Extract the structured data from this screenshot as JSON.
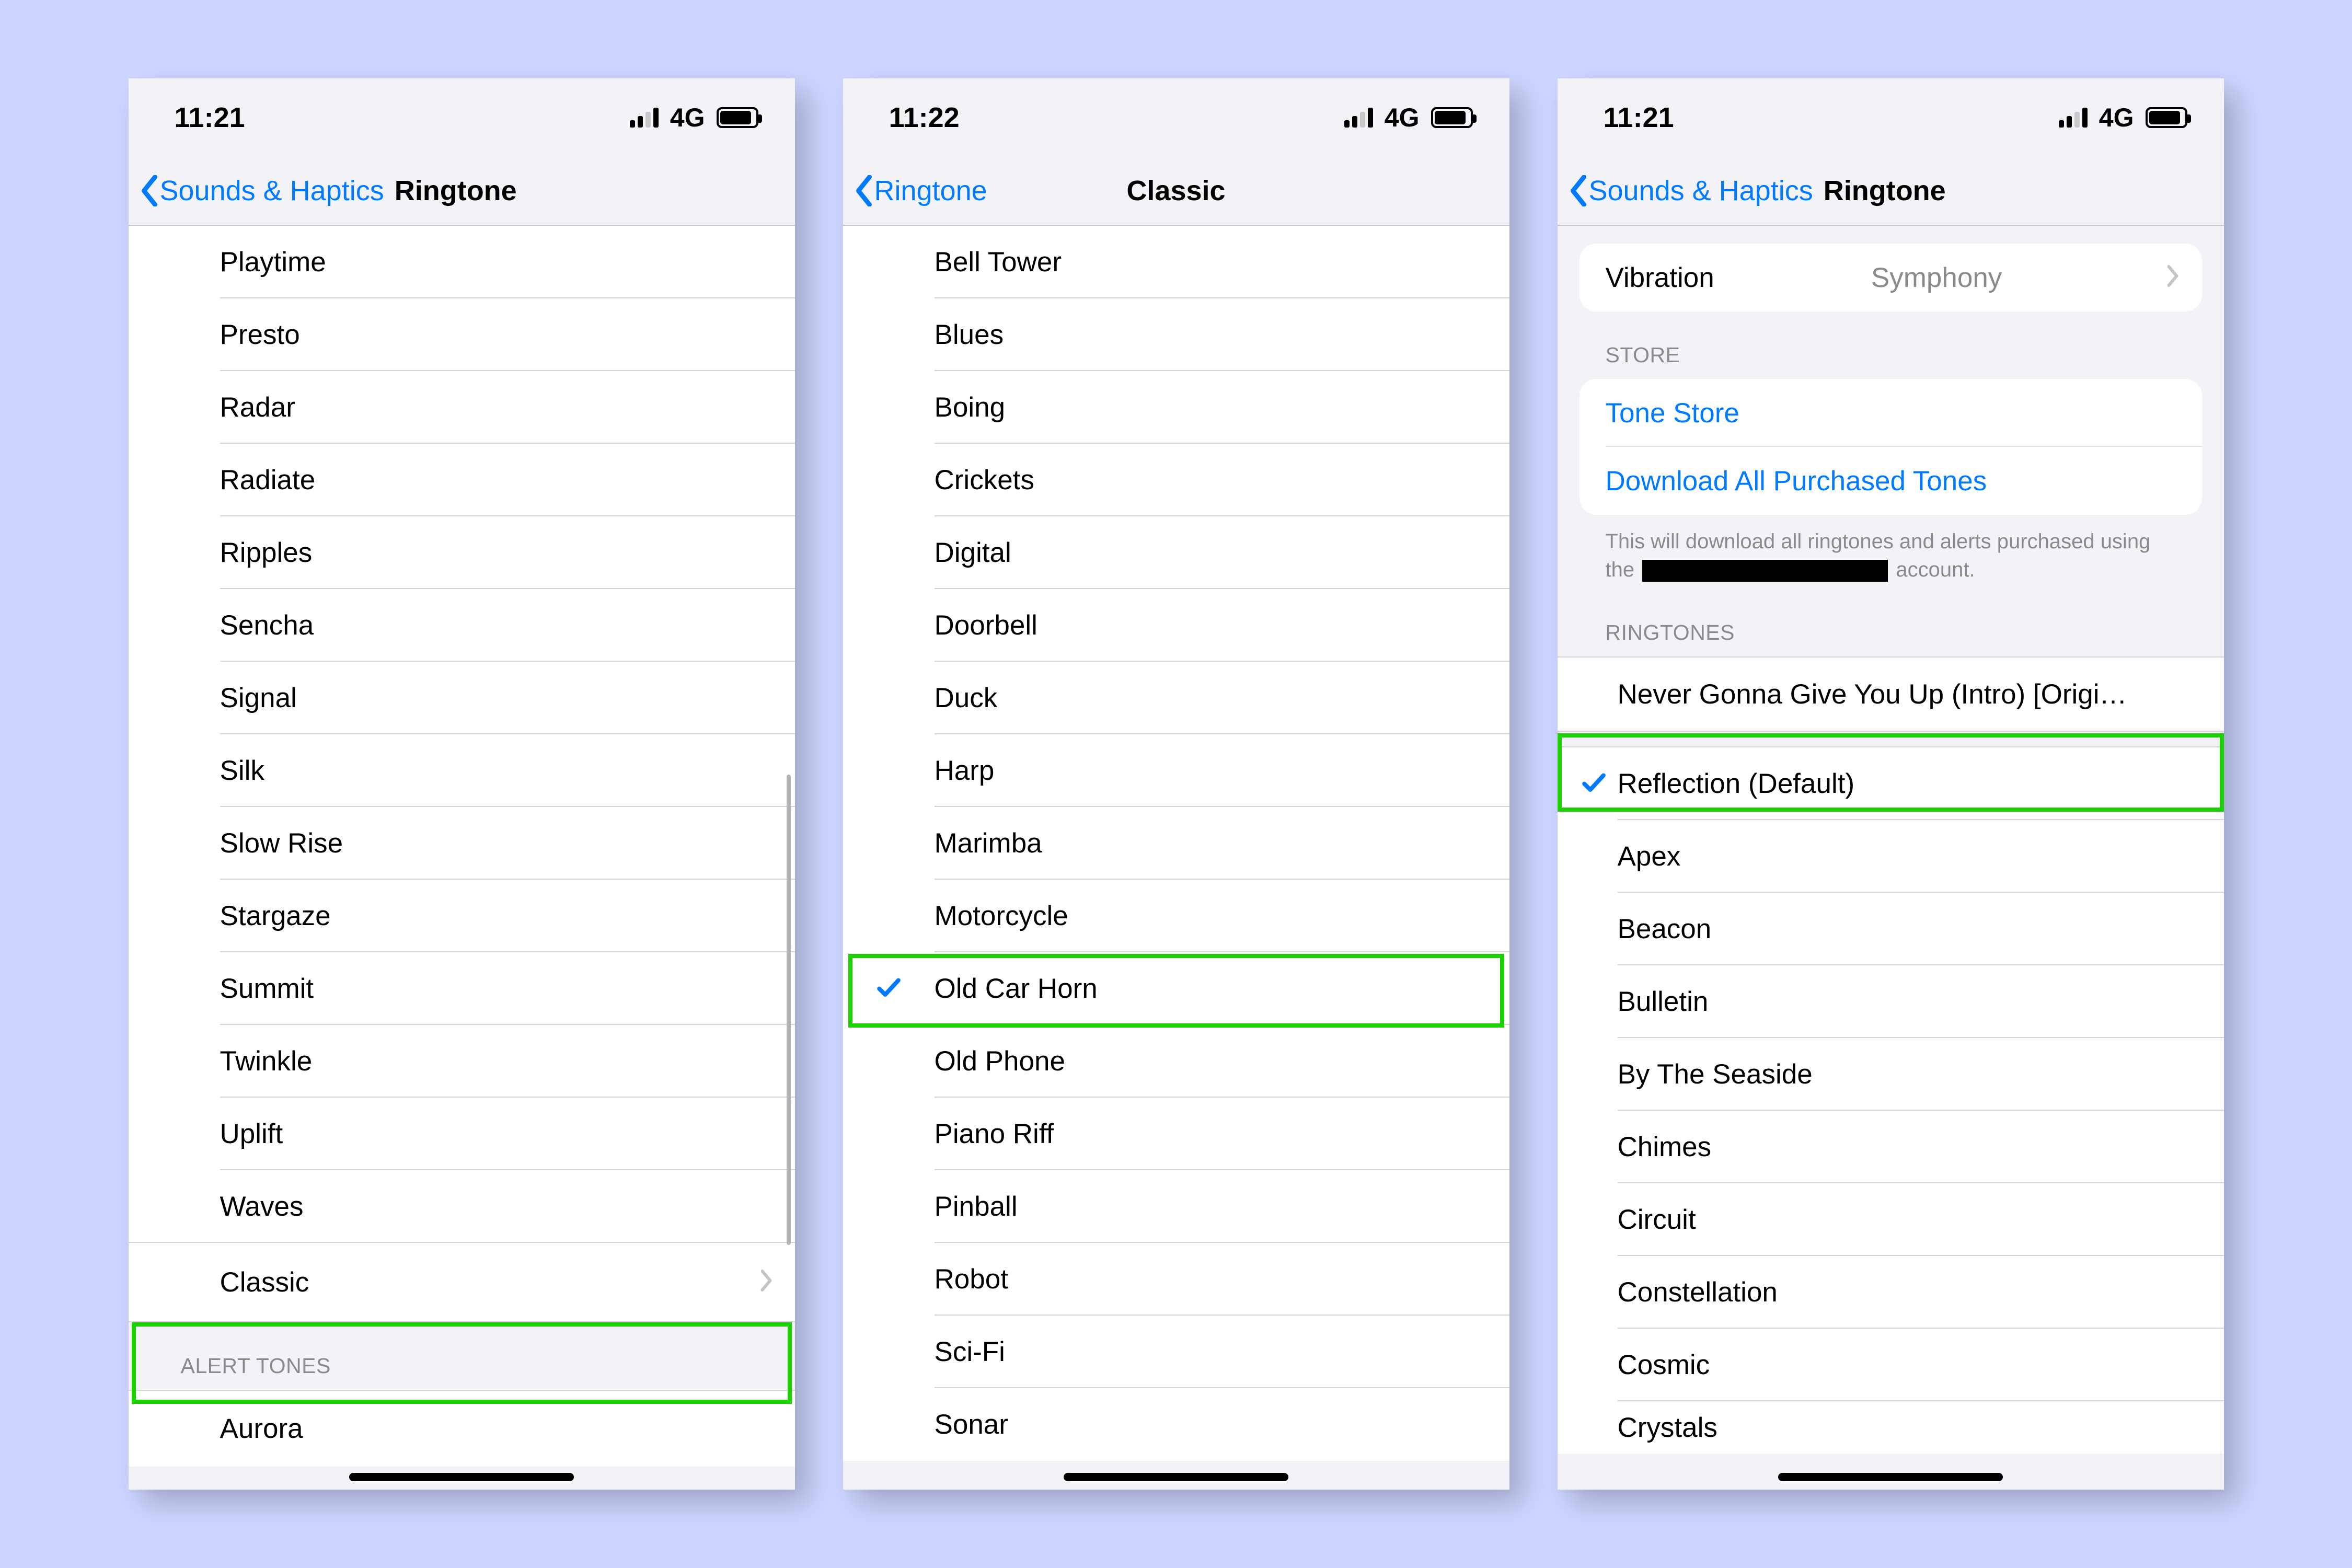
{
  "status": {
    "left_time": "11:21",
    "center_time": "11:22",
    "right_time": "11:21",
    "network": "4G"
  },
  "screen1": {
    "back": "Sounds & Haptics",
    "title": "Ringtone",
    "ringtones": [
      "Playtime",
      "Presto",
      "Radar",
      "Radiate",
      "Ripples",
      "Sencha",
      "Signal",
      "Silk",
      "Slow Rise",
      "Stargaze",
      "Summit",
      "Twinkle",
      "Uplift",
      "Waves"
    ],
    "classic": "Classic",
    "alert_header": "ALERT TONES",
    "alert_first": "Aurora"
  },
  "screen2": {
    "back": "Ringtone",
    "title": "Classic",
    "items": [
      "Bell Tower",
      "Blues",
      "Boing",
      "Crickets",
      "Digital",
      "Doorbell",
      "Duck",
      "Harp",
      "Marimba",
      "Motorcycle",
      "Old Car Horn",
      "Old Phone",
      "Piano Riff",
      "Pinball",
      "Robot",
      "Sci-Fi",
      "Sonar"
    ],
    "checked_index": 10
  },
  "screen3": {
    "back": "Sounds & Haptics",
    "title": "Ringtone",
    "vibration_label": "Vibration",
    "vibration_value": "Symphony",
    "store_header": "STORE",
    "tone_store": "Tone Store",
    "download_all": "Download All Purchased Tones",
    "footer_a": "This will download all ringtones and alerts purchased using the",
    "footer_b": "account.",
    "ringtones_header": "RINGTONES",
    "purchased": "Never Gonna Give You Up (Intro) [Origi…",
    "ringtones": [
      "Reflection (Default)",
      "Apex",
      "Beacon",
      "Bulletin",
      "By The Seaside",
      "Chimes",
      "Circuit",
      "Constellation",
      "Cosmic",
      "Crystals"
    ],
    "checked_index": 0
  }
}
